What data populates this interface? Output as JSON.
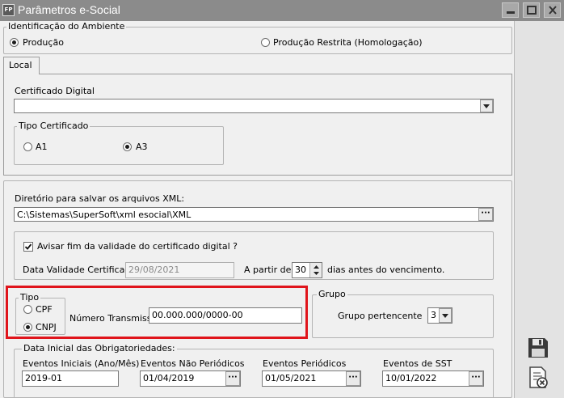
{
  "window": {
    "title": "Parâmetros e-Social",
    "app_icon_text": "FP"
  },
  "ambiente": {
    "legend": "Identificação do Ambiente",
    "options": [
      {
        "label": "Produção",
        "selected": true
      },
      {
        "label": "Produção Restrita (Homologação)",
        "selected": false
      }
    ]
  },
  "tabs": [
    {
      "label": "Local",
      "active": true
    }
  ],
  "certificado": {
    "label": "Certificado Digital",
    "value": ""
  },
  "tipo_certificado": {
    "legend": "Tipo Certificado",
    "options": [
      {
        "label": "A1",
        "selected": false
      },
      {
        "label": "A3",
        "selected": true
      }
    ]
  },
  "diretorio": {
    "label": "Diretório para salvar os arquivos XML:",
    "value": "C:\\Sistemas\\SuperSoft\\xml esocial\\XML"
  },
  "validade": {
    "checkbox_label": "Avisar fim da validade do certificado digital ?",
    "checked": true,
    "data_label": "Data Validade Certificado",
    "data_value": "29/08/2021",
    "apartir_label": "A partir de",
    "dias_value": "30",
    "dias_suffix": "dias antes do vencimento."
  },
  "tipo": {
    "legend": "Tipo",
    "options": [
      {
        "label": "CPF",
        "selected": false
      },
      {
        "label": "CNPJ",
        "selected": true
      }
    ],
    "transmissor_label": "Número Transmissor",
    "transmissor_value": "00.000.000/0000-00"
  },
  "grupo": {
    "legend": "Grupo",
    "label": "Grupo pertencente",
    "value": "3"
  },
  "data_inicial": {
    "legend": "Data Inicial das Obrigatoriedades:",
    "fields": [
      {
        "label": "Eventos Iniciais (Ano/Mês)",
        "value": "2019-01"
      },
      {
        "label": "Eventos Não Periódicos",
        "value": "01/04/2019"
      },
      {
        "label": "Eventos Periódicos",
        "value": "01/05/2021"
      },
      {
        "label": "Eventos de SST",
        "value": "10/01/2022"
      }
    ]
  },
  "colors": {
    "highlight": "#e0141b",
    "titlebar": "#8b8b8b"
  },
  "icons": {
    "save": "floppy-disk-icon",
    "cancel": "cancel-document-icon"
  }
}
